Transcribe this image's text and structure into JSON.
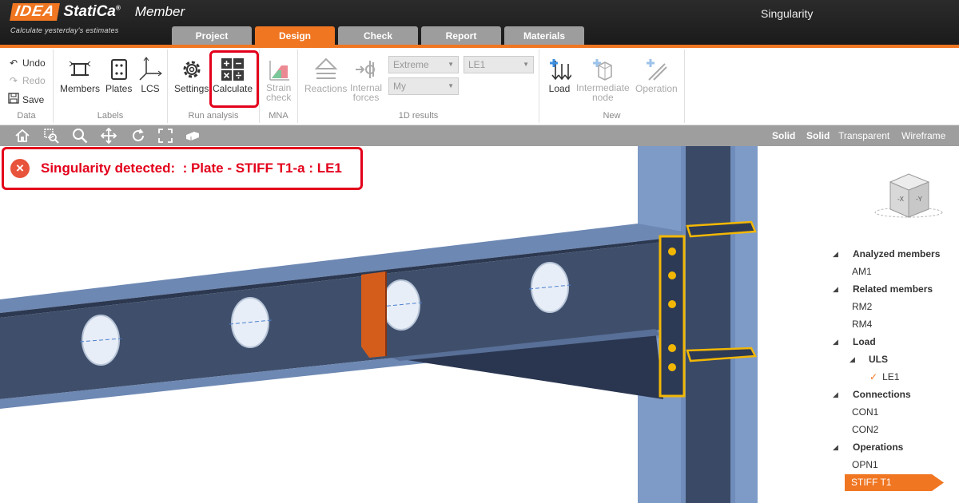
{
  "app": {
    "logo_idea": "IDEA",
    "logo_statica": "StatiCa",
    "logo_reg": "®",
    "product": "Member",
    "tagline": "Calculate yesterday's estimates",
    "window_title": "Singularity"
  },
  "tabs": [
    {
      "label": "Project",
      "active": false
    },
    {
      "label": "Design",
      "active": true
    },
    {
      "label": "Check",
      "active": false
    },
    {
      "label": "Report",
      "active": false
    },
    {
      "label": "Materials",
      "active": false
    }
  ],
  "ribbon": {
    "data": {
      "label": "Data",
      "undo": "Undo",
      "redo": "Redo",
      "save": "Save"
    },
    "labels": {
      "label": "Labels",
      "members": "Members",
      "plates": "Plates",
      "lcs": "LCS"
    },
    "run": {
      "label": "Run analysis",
      "settings": "Settings",
      "calculate": "Calculate"
    },
    "mna": {
      "label": "MNA",
      "strain1": "Strain",
      "strain2": "check"
    },
    "results": {
      "label": "1D results",
      "reactions": "Reactions",
      "internal1": "Internal",
      "internal2": "forces",
      "dd_extreme": "Extreme",
      "dd_le": "LE1",
      "dd_my": "My"
    },
    "new": {
      "label": "New",
      "load": "Load",
      "inter1": "Intermediate",
      "inter2": "node",
      "operation": "Operation"
    }
  },
  "view_modes": [
    {
      "label": "Solid",
      "bold": true
    },
    {
      "label": "Solid",
      "bold": true
    },
    {
      "label": "Transparent",
      "bold": false
    },
    {
      "label": "Wireframe",
      "bold": false
    }
  ],
  "error": {
    "message": "Singularity detected:  : Plate - STIFF T1-a : LE1"
  },
  "cube": {
    "left": "-X",
    "right": "-Y"
  },
  "tree": {
    "analyzed_members": "Analyzed members",
    "am1": "AM1",
    "related_members": "Related members",
    "rm2": "RM2",
    "rm4": "RM4",
    "load": "Load",
    "uls": "ULS",
    "le1": "LE1",
    "connections": "Connections",
    "con1": "CON1",
    "con2": "CON2",
    "operations": "Operations",
    "opn1": "OPN1",
    "stiff": "STIFF T1"
  },
  "colors": {
    "accent": "#f07622",
    "error": "#e3001b",
    "steel": "#3f4f6b",
    "column": "#7f9bc6"
  }
}
